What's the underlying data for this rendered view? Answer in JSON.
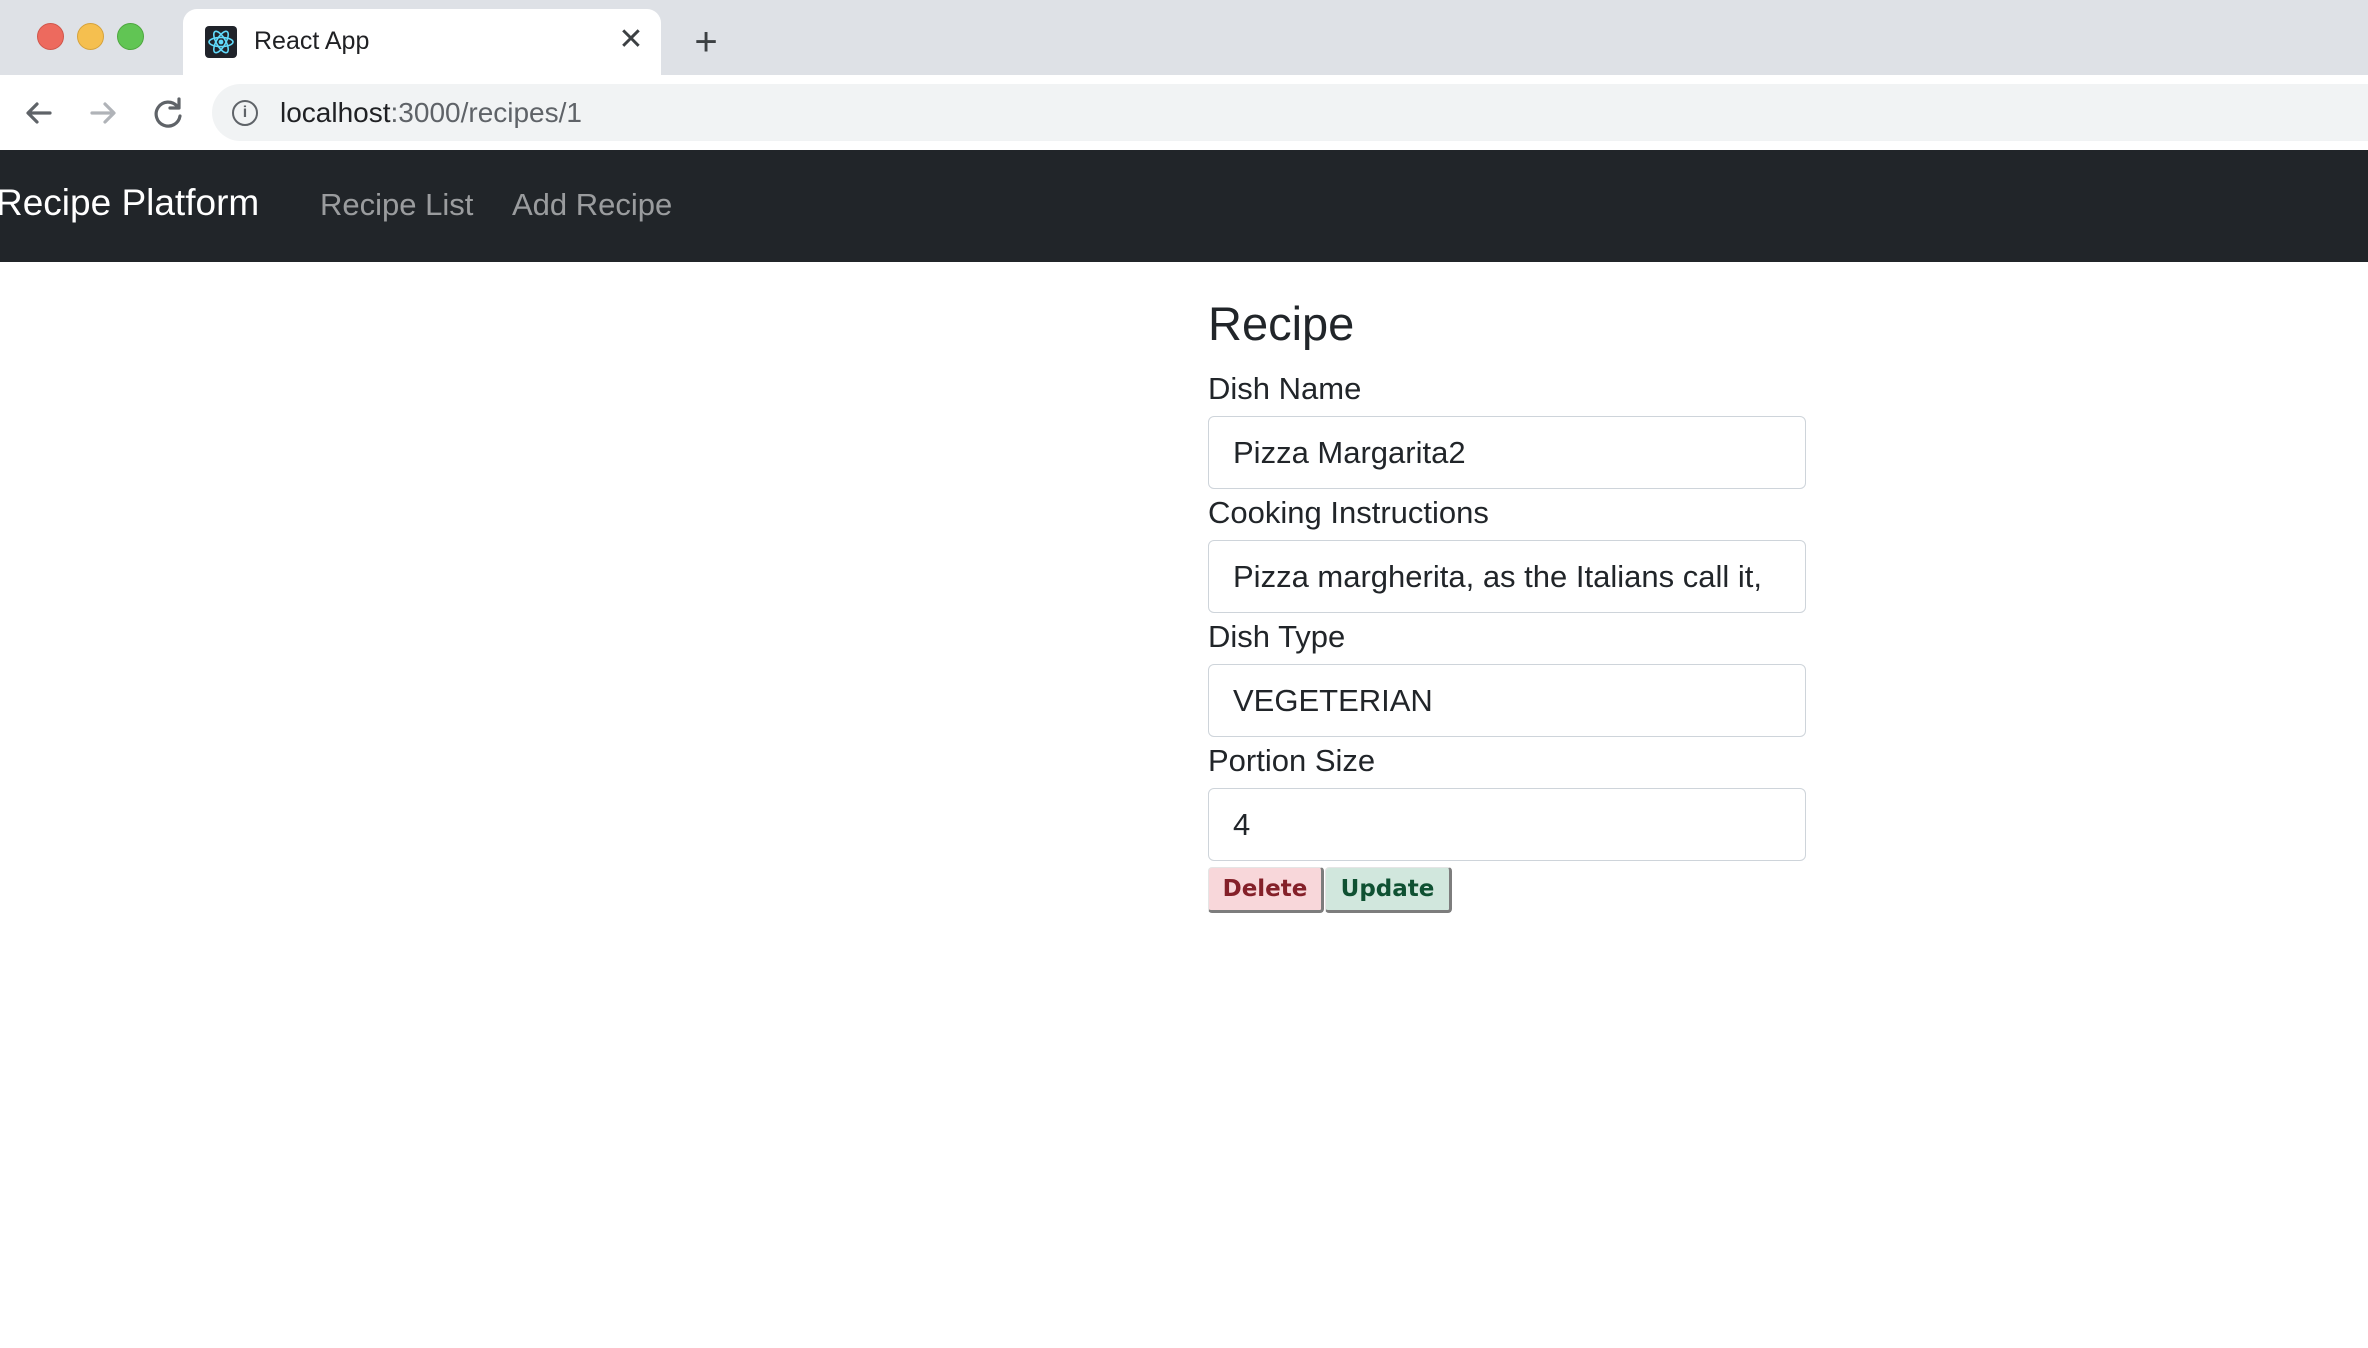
{
  "browser": {
    "tab_title": "React App",
    "new_tab_symbol": "+",
    "close_symbol": "✕",
    "url_host": "localhost",
    "url_path": ":3000/recipes/1"
  },
  "navbar": {
    "brand": "Recipe Platform",
    "links": [
      "Recipe List",
      "Add Recipe"
    ],
    "background": "#212529"
  },
  "form": {
    "heading": "Recipe",
    "fields": [
      {
        "label": "Dish Name",
        "value": "Pizza Margarita2"
      },
      {
        "label": "Cooking Instructions",
        "value": "Pizza margherita, as the Italians call it,"
      },
      {
        "label": "Dish Type",
        "value": "VEGETERIAN"
      },
      {
        "label": "Portion Size",
        "value": "4"
      }
    ],
    "buttons": {
      "delete": "Delete",
      "update": "Update"
    }
  },
  "colors": {
    "delete_bg": "#f8d7da",
    "delete_text": "#842029",
    "update_bg": "#d1e7dd",
    "update_text": "#0f5132"
  },
  "icons": [
    "react-favicon-icon",
    "close-icon",
    "plus-icon",
    "back-arrow-icon",
    "forward-arrow-icon",
    "reload-icon",
    "info-icon"
  ]
}
